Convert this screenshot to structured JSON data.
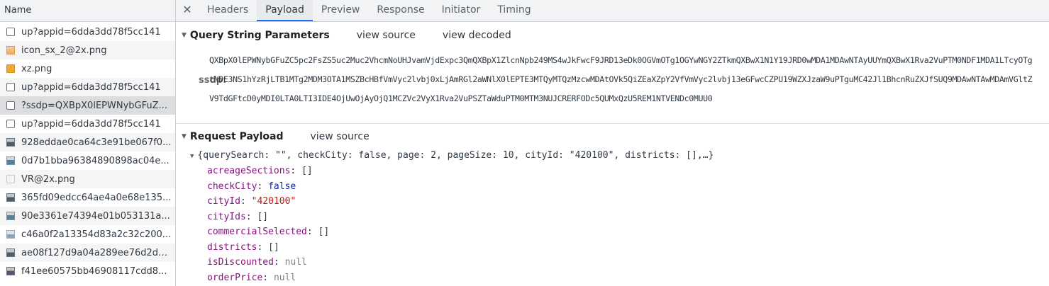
{
  "left_panel": {
    "header": "Name",
    "requests": [
      {
        "label": "up?appid=6dda3dd78f5cc141",
        "icon": "document-icon"
      },
      {
        "label": "icon_sx_2@2x.png",
        "icon": "image-icon"
      },
      {
        "label": "xz.png",
        "icon": "image-icon"
      },
      {
        "label": "up?appid=6dda3dd78f5cc141",
        "icon": "document-icon"
      },
      {
        "label": "?ssdp=QXBpX0lEPWNybGFuZ...",
        "icon": "document-icon"
      },
      {
        "label": "up?appid=6dda3dd78f5cc141",
        "icon": "document-icon"
      },
      {
        "label": "928eddae0ca64c3e91be067f0...",
        "icon": "image-icon"
      },
      {
        "label": "0d7b1bba96384890898ac04e...",
        "icon": "image-icon"
      },
      {
        "label": "VR@2x.png",
        "icon": "image-icon"
      },
      {
        "label": "365fd09edcc64ae4a0e68e135...",
        "icon": "image-icon"
      },
      {
        "label": "90e3361e74394e01b053131a...",
        "icon": "image-icon"
      },
      {
        "label": "c46a0f2a13354d83a2c32c200...",
        "icon": "image-icon"
      },
      {
        "label": "ae08f127d9a04a289ee76d2de...",
        "icon": "image-icon"
      },
      {
        "label": "f41ee60575bb46908117cdd8...",
        "icon": "image-icon"
      }
    ]
  },
  "tabs": {
    "close": "✕",
    "items": [
      "Headers",
      "Payload",
      "Preview",
      "Response",
      "Initiator",
      "Timing"
    ],
    "active": "Payload"
  },
  "query_string": {
    "title": "Query String Parameters",
    "view_source": "view source",
    "view_decoded": "view decoded",
    "key": "ssdp:",
    "value": "QXBpX0lEPWNybGFuZC5pc2FsZS5uc2Muc2VhcmNoUHJvamVjdExpc3QmQXBpX1ZlcnNpb249MS4wJkFwcF9JRD13eDk0OGVmOTg1OGYwNGY2ZTkmQXBwX1N1Y19JRD0wMDA1MDAwNTAyUUYmQXBwX1Rva2VuPTM0NDF1MDA1LTcyOTgtNDE3NS1hYzRjLTB1MTg2MDM3OTA1MSZBcHBfVmVyc2lvbj0xLjAmRGl2aWNlX0lEPTE3MTQyMTQzMzcwMDAtOVk5QiZEaXZpY2VfVmVyc2lvbj13eGFwcCZPU19WZXJzaW9uPTguMC42Jl1BhcnRuZXJfSUQ9MDAwNTAwMDAmVGltZV9TdGFtcD0yMDI0LTA0LTI3IDE4OjUwOjAyOjQ1MCZVc2VyX1Rva2VuPSZTaWduPTM0MTM3NUJCRERFODc5QUMxQzU5REM1NTVENDc0MUU0"
  },
  "request_payload": {
    "title": "Request Payload",
    "view_source": "view source",
    "summary": "{querySearch: \"\", checkCity: false, page: 2, pageSize: 10, cityId: \"420100\", districts: [],…}",
    "props": [
      {
        "key": "acreageSections",
        "value": "[]",
        "type": "obj"
      },
      {
        "key": "checkCity",
        "value": "false",
        "type": "kw"
      },
      {
        "key": "cityId",
        "value": "\"420100\"",
        "type": "str"
      },
      {
        "key": "cityIds",
        "value": "[]",
        "type": "obj"
      },
      {
        "key": "commercialSelected",
        "value": "[]",
        "type": "obj"
      },
      {
        "key": "districts",
        "value": "[]",
        "type": "obj"
      },
      {
        "key": "isDiscounted",
        "value": "null",
        "type": "null"
      },
      {
        "key": "orderPrice",
        "value": "null",
        "type": "null"
      }
    ]
  }
}
